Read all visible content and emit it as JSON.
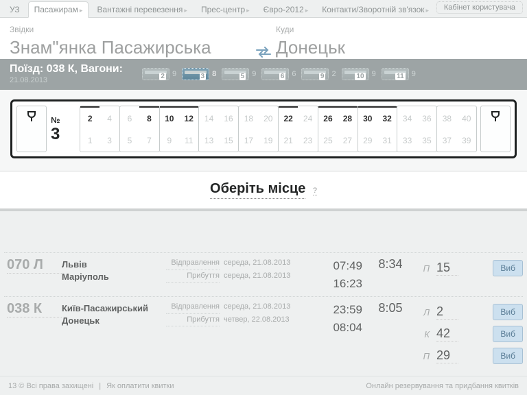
{
  "nav": {
    "items": [
      "УЗ",
      "Пасажирам",
      "Вантажні перевезення",
      "Прес-центр",
      "Євро-2012",
      "Контакти/Зворотній зв'язок"
    ],
    "active_index": 1,
    "cabinet": "Кабінет користувача"
  },
  "search": {
    "from_label": "Звідки",
    "to_label": "Куди",
    "from_value": "Знам\"янка Пасажирська",
    "to_value": "Донецьк"
  },
  "wagon_header": {
    "train_label": "Поїзд: 038 К, Вагони:",
    "date": "21.08.2013",
    "wagons": [
      {
        "num": "2",
        "free": "9",
        "selected": false
      },
      {
        "num": "3",
        "free": "8",
        "selected": true
      },
      {
        "num": "5",
        "free": "9",
        "selected": false
      },
      {
        "num": "6",
        "free": "6",
        "selected": false
      },
      {
        "num": "9",
        "free": "2",
        "selected": false
      },
      {
        "num": "10",
        "free": "9",
        "selected": false
      },
      {
        "num": "11",
        "free": "9",
        "selected": false
      }
    ]
  },
  "car": {
    "no_label": "№",
    "no_value": "3",
    "coupes": [
      {
        "top": [
          {
            "n": "2",
            "a": true
          },
          {
            "n": "4",
            "a": false
          }
        ],
        "bot": [
          {
            "n": "1",
            "a": false
          },
          {
            "n": "3",
            "a": false
          }
        ]
      },
      {
        "top": [
          {
            "n": "6",
            "a": false
          },
          {
            "n": "8",
            "a": true
          }
        ],
        "bot": [
          {
            "n": "5",
            "a": false
          },
          {
            "n": "7",
            "a": false
          }
        ]
      },
      {
        "top": [
          {
            "n": "10",
            "a": true
          },
          {
            "n": "12",
            "a": true
          }
        ],
        "bot": [
          {
            "n": "9",
            "a": false
          },
          {
            "n": "11",
            "a": false
          }
        ]
      },
      {
        "top": [
          {
            "n": "14",
            "a": false
          },
          {
            "n": "16",
            "a": false
          }
        ],
        "bot": [
          {
            "n": "13",
            "a": false
          },
          {
            "n": "15",
            "a": false
          }
        ]
      },
      {
        "top": [
          {
            "n": "18",
            "a": false
          },
          {
            "n": "20",
            "a": false
          }
        ],
        "bot": [
          {
            "n": "17",
            "a": false
          },
          {
            "n": "19",
            "a": false
          }
        ]
      },
      {
        "top": [
          {
            "n": "22",
            "a": true
          },
          {
            "n": "24",
            "a": false
          }
        ],
        "bot": [
          {
            "n": "21",
            "a": false
          },
          {
            "n": "23",
            "a": false
          }
        ]
      },
      {
        "top": [
          {
            "n": "26",
            "a": true
          },
          {
            "n": "28",
            "a": true
          }
        ],
        "bot": [
          {
            "n": "25",
            "a": false
          },
          {
            "n": "27",
            "a": false
          }
        ]
      },
      {
        "top": [
          {
            "n": "30",
            "a": true
          },
          {
            "n": "32",
            "a": true
          }
        ],
        "bot": [
          {
            "n": "29",
            "a": false
          },
          {
            "n": "31",
            "a": false
          }
        ]
      },
      {
        "top": [
          {
            "n": "34",
            "a": false
          },
          {
            "n": "36",
            "a": false
          }
        ],
        "bot": [
          {
            "n": "33",
            "a": false
          },
          {
            "n": "35",
            "a": false
          }
        ]
      },
      {
        "top": [
          {
            "n": "38",
            "a": false
          },
          {
            "n": "40",
            "a": false
          }
        ],
        "bot": [
          {
            "n": "37",
            "a": false
          },
          {
            "n": "39",
            "a": false
          }
        ]
      }
    ]
  },
  "prompt": {
    "text": "Оберіть місце",
    "help": "?"
  },
  "results": [
    {
      "num": "070 Л",
      "route_from": "Львів",
      "route_to": "Маріуполь",
      "dep_label": "Відправлення",
      "arr_label": "Прибуття",
      "dep_date": "середа, 21.08.2013",
      "arr_date": "середа, 21.08.2013",
      "dep_time": "07:49",
      "arr_time": "16:23",
      "duration": "8:34",
      "classes": [
        {
          "letter": "П",
          "count": "15",
          "btn": "Виб"
        }
      ]
    },
    {
      "num": "038 К",
      "route_from": "Київ-Пасажирський",
      "route_to": "Донецьк",
      "dep_label": "Відправлення",
      "arr_label": "Прибуття",
      "dep_date": "середа, 21.08.2013",
      "arr_date": "четвер, 22.08.2013",
      "dep_time": "23:59",
      "arr_time": "08:04",
      "duration": "8:05",
      "classes": [
        {
          "letter": "Л",
          "count": "2",
          "btn": "Виб"
        },
        {
          "letter": "К",
          "count": "42",
          "btn": "Виб"
        },
        {
          "letter": "П",
          "count": "29",
          "btn": "Виб"
        }
      ]
    }
  ],
  "footer": {
    "copyright": "13 © Всі права захищені",
    "payments": "Як оплатити квитки",
    "right": "Онлайн резервування та придбання квитків"
  }
}
